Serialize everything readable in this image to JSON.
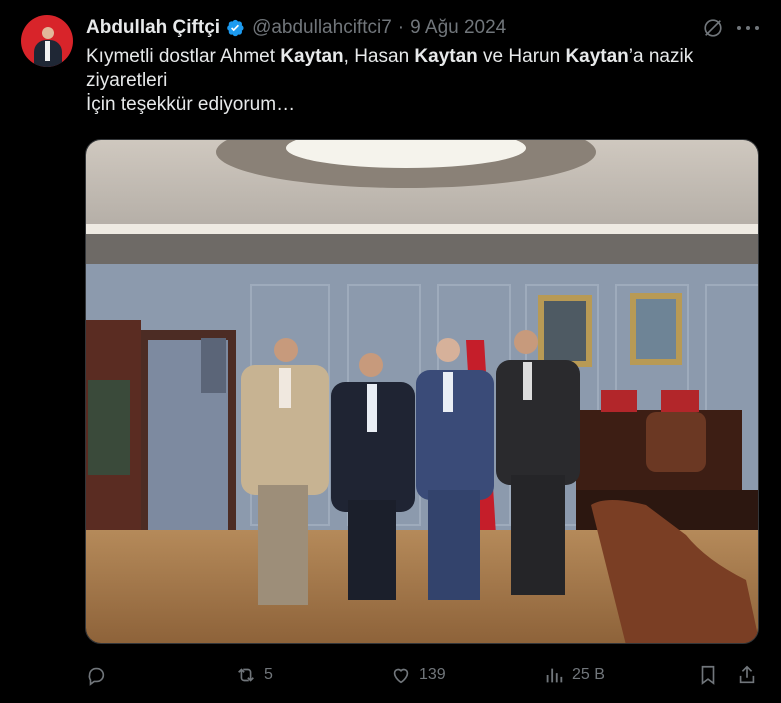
{
  "author": {
    "name": "Abdullah Çiftçi",
    "handle": "@abdullahciftci7",
    "separator": "·",
    "date": "9 Ağu 2024"
  },
  "post": {
    "line1": {
      "p1": "Kıymetli dostlar Ahmet ",
      "b1": "Kaytan",
      "p2": ", Hasan ",
      "b2": "Kaytan",
      "p3": " ve Harun ",
      "b3": "Kaytan",
      "p4": "’a nazik"
    },
    "line2": "ziyaretleri",
    "line3": "İçin teşekkür ediyorum…"
  },
  "image": {
    "description_icon": "photo",
    "scene": "four men standing in an office"
  },
  "actions": {
    "reply": {
      "icon": "reply-icon",
      "count": ""
    },
    "repost": {
      "icon": "repost-icon",
      "count": "5"
    },
    "like": {
      "icon": "heart-icon",
      "count": "139"
    },
    "views": {
      "icon": "views-icon",
      "count": "25 B"
    },
    "bookmark": {
      "icon": "bookmark-icon"
    },
    "share": {
      "icon": "share-icon"
    }
  },
  "colors": {
    "background": "#000000",
    "text": "#e7e9ea",
    "muted": "#71767b",
    "verified": "#1d9bf0",
    "avatar_bg": "#d8242a"
  }
}
